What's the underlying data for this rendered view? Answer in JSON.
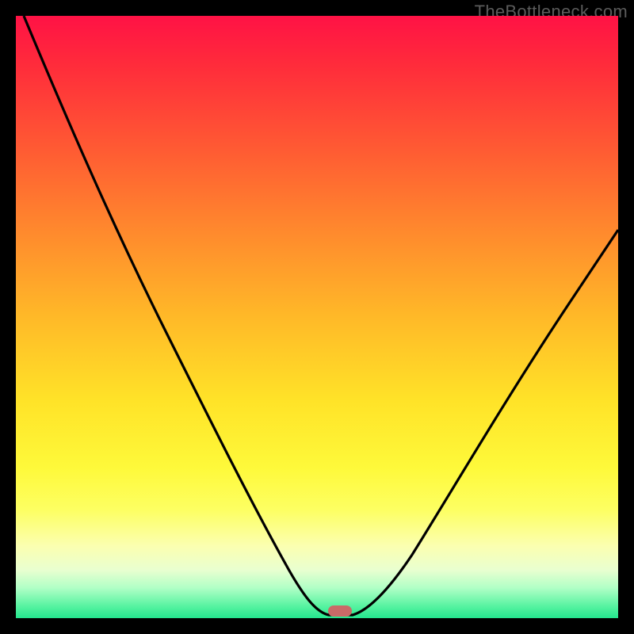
{
  "watermark": "TheBottleneck.com",
  "marker_color": "#c96a67",
  "chart_data": {
    "type": "line",
    "title": "",
    "xlabel": "",
    "ylabel": "",
    "xlim": [
      0,
      100
    ],
    "ylim": [
      0,
      100
    ],
    "grid": false,
    "x": [
      0,
      5,
      10,
      15,
      20,
      25,
      30,
      35,
      40,
      43,
      47,
      50,
      52,
      55,
      58,
      62,
      67,
      74,
      82,
      90,
      100
    ],
    "y": [
      100,
      90,
      80,
      71,
      62,
      53,
      44,
      35,
      24,
      15,
      6,
      1,
      0,
      0,
      1,
      5,
      12,
      23,
      36,
      50,
      64
    ],
    "marker": {
      "x": 53.5,
      "y": 1.3
    },
    "gradient_scale": [
      "good",
      "warning",
      "bad"
    ]
  }
}
